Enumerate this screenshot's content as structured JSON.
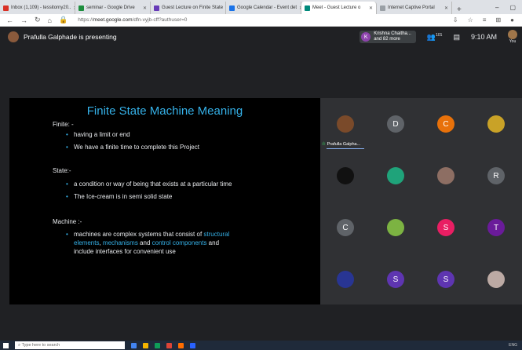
{
  "browser": {
    "tabs": [
      {
        "label": "Inbox (1,109) - tessitorny20..",
        "color": "#d93025",
        "active": false
      },
      {
        "label": "seminar - Google Drive",
        "color": "#1e8e3e",
        "active": false
      },
      {
        "label": "Guest Lecture on Finite State",
        "color": "#673ab7",
        "active": false
      },
      {
        "label": "Google Calendar - Event det",
        "color": "#1a73e8",
        "active": false
      },
      {
        "label": "Meet - Guest Lecture o",
        "color": "#00897b",
        "active": true
      },
      {
        "label": "Internet Captive Portal",
        "color": "#9aa0a6",
        "active": false
      }
    ],
    "url_prefix": "https://",
    "url_host": "meet.google.com",
    "url_path": "/dfn-vyjb-cff?authuser=0"
  },
  "meet": {
    "presenting_text": "Prafulla Galphade is presenting",
    "chip_initial": "K",
    "chip_name": "Krishna Chaitha...",
    "chip_more": "and 82 more",
    "participants_count": "101",
    "time": "9:10 AM",
    "you_label": "You"
  },
  "slide": {
    "title": "Finite State Machine Meaning",
    "finite_heading": "Finite: -",
    "finite_bullets": [
      "having a limit or end",
      "We have a finite time to complete this Project"
    ],
    "state_heading": "State:-",
    "state_bullets": [
      "a condition or way of being that exists at a particular time",
      "The Ice-cream is in semi solid state"
    ],
    "machine_heading": "Machine :-",
    "machine_bullet": {
      "p1": "machines are complex systems that consist of ",
      "h1": "structural",
      "h2": "elements",
      "p2": ", ",
      "h3": "mechanisms",
      "p3": " and ",
      "h4": "control components",
      "p4": " and",
      "line3": "include interfaces for convenient use"
    }
  },
  "participants": [
    {
      "type": "photo",
      "color": "#7a4a2a",
      "label": "Prafulla Galpha..."
    },
    {
      "type": "letter",
      "letter": "D",
      "color": "#5f6368"
    },
    {
      "type": "letter",
      "letter": "C",
      "color": "#e8710a"
    },
    {
      "type": "photo",
      "color": "#c9a227"
    },
    {
      "type": "photo",
      "color": "#111111"
    },
    {
      "type": "photo",
      "color": "#1fa37a"
    },
    {
      "type": "photo",
      "color": "#8d6e63"
    },
    {
      "type": "letter",
      "letter": "R",
      "color": "#5f6368"
    },
    {
      "type": "letter",
      "letter": "C",
      "color": "#5f6368"
    },
    {
      "type": "photo",
      "color": "#7cb342"
    },
    {
      "type": "letter",
      "letter": "S",
      "color": "#e91e63"
    },
    {
      "type": "letter",
      "letter": "T",
      "color": "#6a1b9a"
    },
    {
      "type": "photo",
      "color": "#283593"
    },
    {
      "type": "letter",
      "letter": "S",
      "color": "#5e35b1"
    },
    {
      "type": "letter",
      "letter": "S",
      "color": "#5e35b1"
    },
    {
      "type": "photo",
      "color": "#bcaaa4"
    }
  ],
  "taskbar": {
    "search_placeholder": "Type here to search",
    "tray_lang": "ENG"
  }
}
